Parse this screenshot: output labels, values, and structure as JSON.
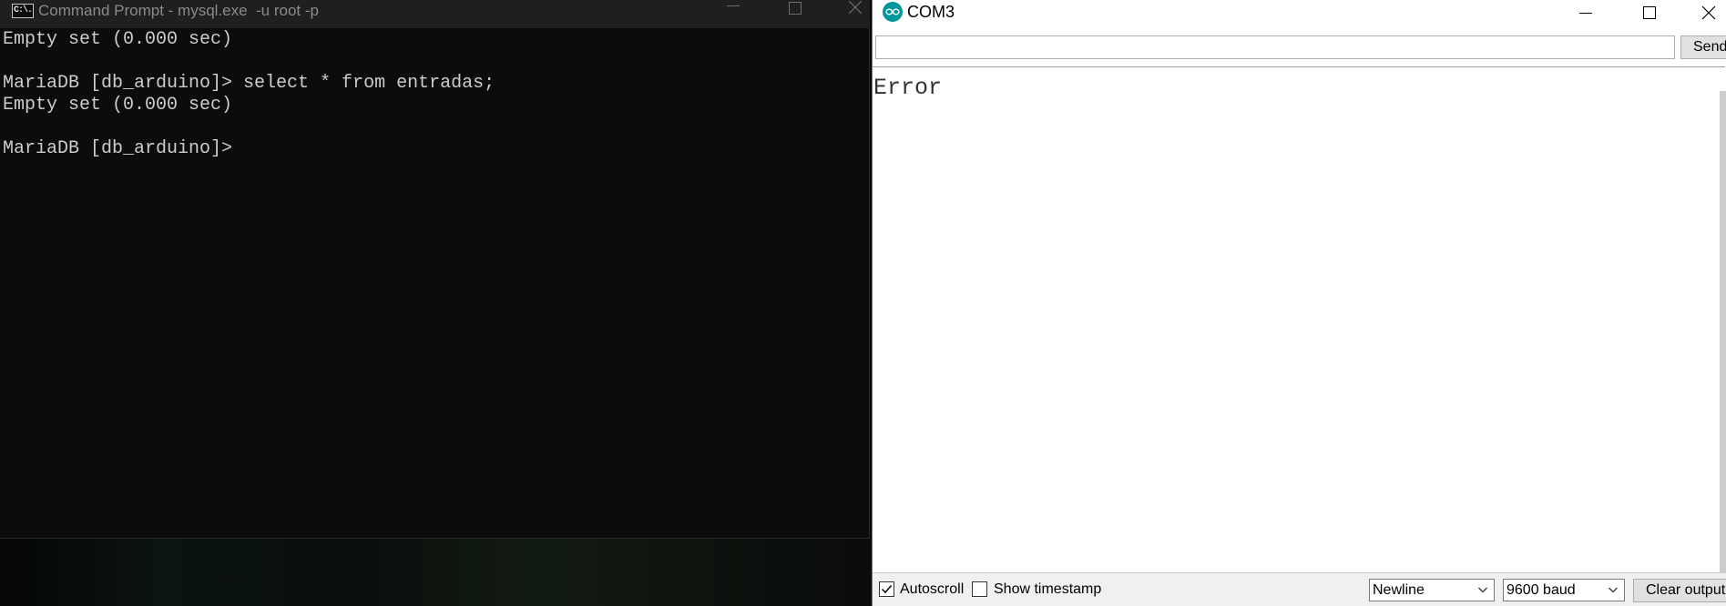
{
  "cmd_window": {
    "title": "Command Prompt - mysql.exe  -u root -p",
    "icon_text": "C:\\.",
    "lines": [
      "Empty set (0.000 sec)",
      "",
      "MariaDB [db_arduino]> select * from entradas;",
      "Empty set (0.000 sec)",
      "",
      "MariaDB [db_arduino]>"
    ],
    "icons": {
      "app": "cmd-icon",
      "minimize": "minimize-icon",
      "maximize": "maximize-icon",
      "close": "close-icon"
    }
  },
  "serial_monitor": {
    "title": "COM3",
    "app_icon": "arduino-logo-icon",
    "accent_color": "#00979C",
    "send_input": {
      "value": "",
      "placeholder": ""
    },
    "send_label": "Send",
    "output_lines": [
      "Error"
    ],
    "autoscroll": {
      "label": "Autoscroll",
      "checked": true
    },
    "show_timestamp": {
      "label": "Show timestamp",
      "checked": false
    },
    "line_ending": "Newline",
    "baud_rate": "9600 baud",
    "clear_label": "Clear output",
    "icons": {
      "minimize": "minimize-icon",
      "maximize": "maximize-icon",
      "close": "close-icon",
      "checkmark": "checkmark-icon",
      "dropdown": "chevron-down-icon"
    }
  }
}
